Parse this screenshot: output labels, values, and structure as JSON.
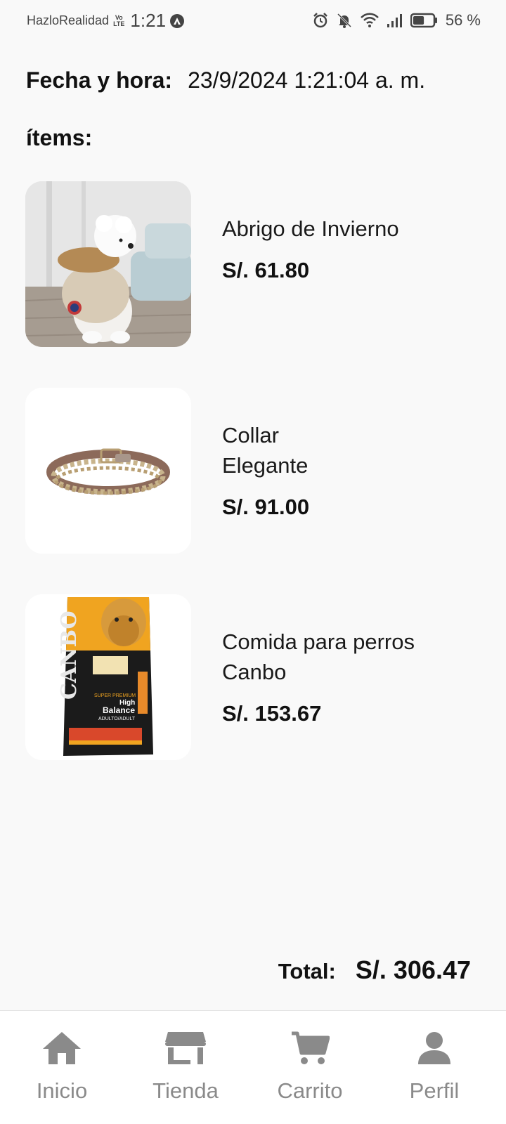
{
  "status_bar": {
    "carrier": "HazloRealidad",
    "volte_top": "Vo",
    "volte_bottom": "LTE",
    "time": "1:21",
    "battery_percent": "56 %",
    "battery_level": 0.56
  },
  "header": {
    "datetime_label": "Fecha y hora:",
    "datetime_value": "23/9/2024 1:21:04 a. m.",
    "items_label": "ítems:"
  },
  "items": [
    {
      "name": "Abrigo de Invierno",
      "price": "S/. 61.80",
      "image_icon": "dog-coat-photo"
    },
    {
      "name": "Collar Elegante",
      "price": "S/. 91.00",
      "image_icon": "collar-photo"
    },
    {
      "name": "Comida para perros Canbo",
      "price": "S/. 153.67",
      "image_icon": "dog-food-bag-photo"
    }
  ],
  "food_bag": {
    "brand": "CANBO",
    "line1": "SUPER PREMIUM",
    "line2": "High",
    "line3": "Balance",
    "line4": "ADULTO/ADULT"
  },
  "total": {
    "label": "Total:",
    "value": "S/. 306.47"
  },
  "nav": [
    {
      "label": "Inicio",
      "icon": "home-icon"
    },
    {
      "label": "Tienda",
      "icon": "store-icon"
    },
    {
      "label": "Carrito",
      "icon": "cart-icon"
    },
    {
      "label": "Perfil",
      "icon": "person-icon"
    }
  ],
  "colors": {
    "background": "#f9f9f9",
    "nav_icon": "#8a8a8a",
    "text": "#111111"
  }
}
